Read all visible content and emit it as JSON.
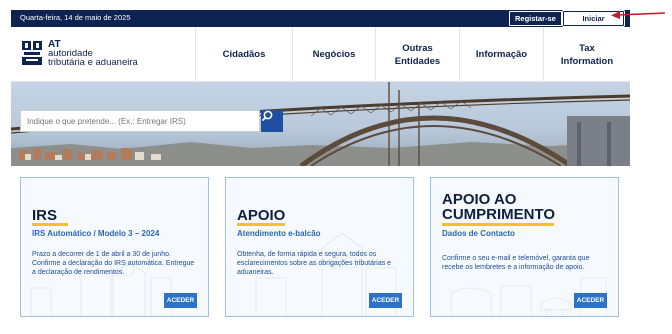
{
  "topbar": {
    "date": "Quarta-feira, 14 de maio de 2025",
    "register_label": "Registar-se",
    "login_label": "Iniciar Sessão"
  },
  "logo": {
    "line1": "AT",
    "line2": "autoridade",
    "line3": "tributária e aduaneira"
  },
  "nav": [
    {
      "label": "Cidadãos"
    },
    {
      "label": "Negócios"
    },
    {
      "label": "Outras Entidades"
    },
    {
      "label": "Informação"
    },
    {
      "label": "Tax Information"
    }
  ],
  "search": {
    "placeholder": "Indique o que pretende... (Ex.: Entregar IRS)"
  },
  "cards": [
    {
      "title": "IRS",
      "subtitle": "IRS Automático / Modelo 3 – 2024",
      "body": "Prazo a decorrer de 1 de abril a 30 de junho. Confirme a declaração do IRS automática. Entregue a declaração de rendimentos.",
      "button": "ACEDER"
    },
    {
      "title": "APOIO",
      "subtitle": "Atendimento e-balcão",
      "body": "Obtenha, de forma rápida e segura, todos os esclarecimentos sobre as obrigações tributárias e aduaneiras.",
      "button": "ACEDER"
    },
    {
      "title": "APOIO AO CUMPRIMENTO",
      "subtitle": "Dados de Contacto",
      "body": "Confirme o seu e-mail e telemóvel, garanta que recebe os lembretes e a informação de apoio.",
      "button": "ACEDER"
    }
  ],
  "colors": {
    "navy": "#0f2350",
    "accent_blue": "#2b72c9",
    "underline_yellow": "#f2c22e",
    "annotation_red": "#c0202a"
  }
}
